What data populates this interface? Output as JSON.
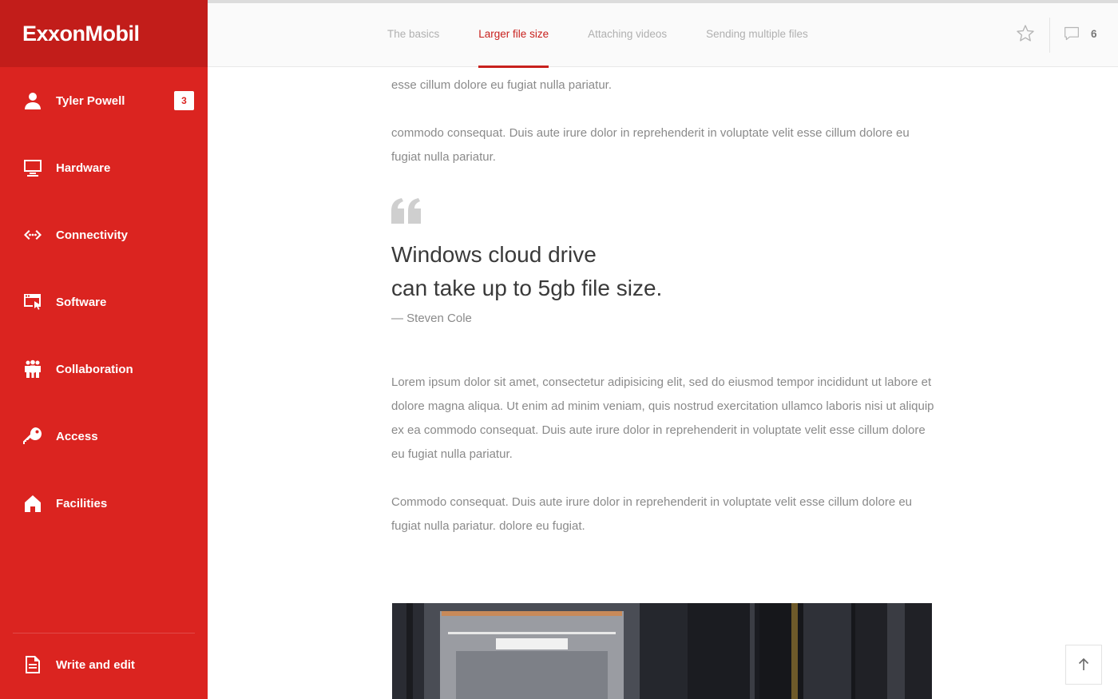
{
  "brand": {
    "logo_text": "ExxonMobil"
  },
  "sidebar": {
    "user": {
      "name": "Tyler Powell",
      "badge": "3"
    },
    "items": [
      {
        "label": "Hardware",
        "icon": "monitor-icon"
      },
      {
        "label": "Connectivity",
        "icon": "connectivity-icon"
      },
      {
        "label": "Software",
        "icon": "software-window-icon"
      },
      {
        "label": "Collaboration",
        "icon": "people-icon"
      },
      {
        "label": "Access",
        "icon": "key-icon"
      },
      {
        "label": "Facilities",
        "icon": "home-icon"
      }
    ],
    "footer_item": {
      "label": "Write and edit",
      "icon": "document-icon"
    }
  },
  "topbar": {
    "tabs": [
      {
        "label": "The basics",
        "active": false
      },
      {
        "label": "Larger file size",
        "active": true
      },
      {
        "label": "Attaching videos",
        "active": false
      },
      {
        "label": "Sending multiple files",
        "active": false
      }
    ],
    "comment_count": "6"
  },
  "content": {
    "paragraphs_top": [
      "esse cillum dolore eu fugiat nulla pariatur.",
      "commodo consequat. Duis aute irure dolor in reprehenderit in voluptate velit esse cillum dolore eu fugiat nulla pariatur."
    ],
    "quote": {
      "line1": "Windows cloud drive",
      "line2": "can take up to 5gb file size.",
      "author": "— Steven Cole"
    },
    "paragraphs_bottom": [
      "Lorem ipsum dolor sit amet, consectetur adipisicing elit, sed do eiusmod tempor incididunt ut labore et dolore magna aliqua. Ut enim ad minim veniam, quis nostrud exercitation ullamco laboris nisi ut aliquip ex ea commodo consequat. Duis aute irure dolor in reprehenderit in voluptate velit esse cillum dolore eu fugiat nulla pariatur.",
      "Commodo consequat. Duis aute irure dolor in reprehenderit in voluptate velit esse cillum dolore eu fugiat nulla pariatur. dolore eu fugiat."
    ]
  },
  "colors": {
    "brand_red": "#db2420",
    "brand_dark_red": "#c21d1a",
    "active_tab": "#c8201d"
  }
}
